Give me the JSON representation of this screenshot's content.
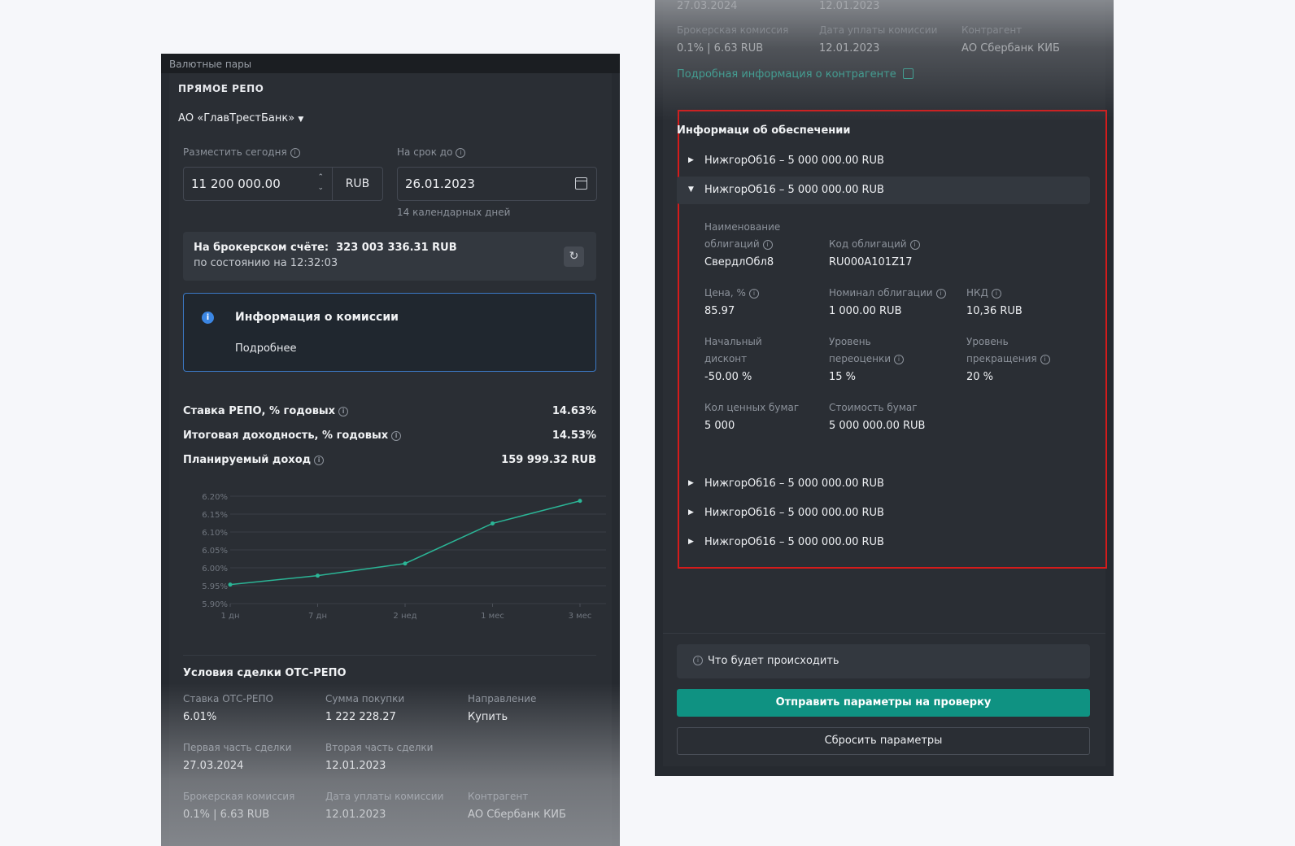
{
  "left": {
    "top_strip": "Валютные пары",
    "section_title": "ПРЯМОЕ РЕПО",
    "bank_selector": "АО «ГлавТрестБанк»",
    "place_today_label": "Разместить сегодня",
    "amount_value": "11 200 000.00",
    "currency": "RUB",
    "term_label": "На срок до",
    "date_value": "26.01.2023",
    "days_hint": "14 календарных дней",
    "balance_label": "На брокерском счёте:",
    "balance_value": "323 003 336.31 RUB",
    "balance_time": "по состоянию на 12:32:03",
    "commission_title": "Информация о комиссии",
    "commission_link": "Подробнее",
    "repo_rate_label": "Ставка РЕПО, % годовых",
    "repo_rate_value": "14.63%",
    "yield_label": "Итоговая доходность, % годовых",
    "yield_value": "14.53%",
    "income_label": "Планируемый доход",
    "income_value": "159 999.32 RUB",
    "conditions_title": "Условия сделки ОТС-РЕПО",
    "conditions": [
      [
        {
          "k": "Ставка ОТС-РЕПО",
          "v": "6.01%"
        },
        {
          "k": "Сумма покупки",
          "v": "1 222 228.27"
        },
        {
          "k": "Направление",
          "v": "Купить"
        }
      ],
      [
        {
          "k": "Первая часть сделки",
          "v": "27.03.2024"
        },
        {
          "k": "Вторая часть сделки",
          "v": "12.01.2023"
        }
      ],
      [
        {
          "k": "Брокерская комиссия",
          "v": "0.1% | 6.63 RUB"
        },
        {
          "k": "Дата уплаты комиссии",
          "v": "12.01.2023"
        },
        {
          "k": "Контрагент",
          "v": "АО Сбербанк КИБ"
        }
      ]
    ]
  },
  "chart_data": {
    "type": "line",
    "categories": [
      "1 дн",
      "7 дн",
      "2 нед",
      "1 мес",
      "3 мес"
    ],
    "series": [
      {
        "values": [
          5.953,
          5.978,
          6.012,
          6.124,
          6.187
        ]
      }
    ],
    "y_ticks": [
      "6.20%",
      "6.15%",
      "6.10%",
      "6.05%",
      "6.00%",
      "5.95%",
      "5.90%"
    ],
    "ylim": [
      5.9,
      6.2
    ],
    "grid": true,
    "color": "#2bb596"
  },
  "right": {
    "top_cut": [
      "27.03.2024",
      "12.01.2023"
    ],
    "fees": [
      {
        "k": "Брокерская комиссия",
        "v": "0.1% | 6.63 RUB"
      },
      {
        "k": "Дата уплаты комиссии",
        "v": "12.01.2023"
      },
      {
        "k": "Контрагент",
        "v": "АО Сбербанк КИБ"
      }
    ],
    "counterparty_link": "Подробная информация о контрагенте",
    "collateral_title": "Информаци об обеспечении",
    "accordion": [
      "НижгорОб16 – 5 000 000.00 RUB",
      "НижгорОб16 – 5 000 000.00 RUB",
      "НижгорОб16 – 5 000 000.00 RUB",
      "НижгорОб16 – 5 000 000.00 RUB",
      "НижгорОб16 – 5 000 000.00 RUB"
    ],
    "details": {
      "bond_name_label": "Наименование облигаций",
      "bond_name": "СвердлОбл8",
      "bond_code_label": "Код облигаций",
      "bond_code": "RU000A101Z17",
      "price_label": "Цена, %",
      "price": "85.97",
      "nominal_label": "Номинал облигации",
      "nominal": "1 000.00 RUB",
      "nkd_label": "НКД",
      "nkd": "10,36 RUB",
      "discount_label": "Начальный дисконт",
      "discount": "-50.00 %",
      "reval_label": "Уровень переоценки",
      "reval": "15 %",
      "stop_label": "Уровень прекращения",
      "stop": "20 %",
      "qty_label": "Кол ценных бумаг",
      "qty": "5 000",
      "cost_label": "Стоимость бумаг",
      "cost": "5 000 000.00 RUB"
    },
    "what_happens": "Что будет происходить",
    "submit_button": "Отправить параметры на проверку",
    "reset_button": "Сбросить параметры"
  }
}
